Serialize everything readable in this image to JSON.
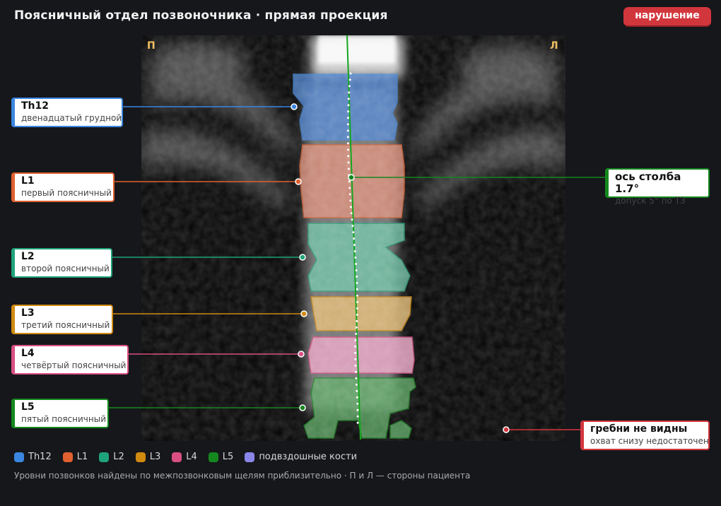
{
  "header": {
    "title": "Поясничный отдел позвоночника · прямая проекция",
    "status_badge": "нарушение"
  },
  "scan": {
    "side_right": "П",
    "side_left": "Л"
  },
  "vertebrae": [
    {
      "code": "Th12",
      "name": "двенадцатый грудной",
      "color": "#3a86e0"
    },
    {
      "code": "L1",
      "name": "первый поясничный",
      "color": "#e06030"
    },
    {
      "code": "L2",
      "name": "второй поясничный",
      "color": "#1fa37a"
    },
    {
      "code": "L3",
      "name": "третий поясничный",
      "color": "#d08a10"
    },
    {
      "code": "L4",
      "name": "четвёртый поясничный",
      "color": "#d94f82"
    },
    {
      "code": "L5",
      "name": "пятый поясничный",
      "color": "#14881e"
    }
  ],
  "axis_callout": {
    "title": "ось столба 1.7°",
    "subtitle": "допуск 5° по ТЗ",
    "color": "#14881e"
  },
  "warning_callout": {
    "title": "гребни не видны",
    "subtitle": "охват снизу недостаточен",
    "color": "#d2363d"
  },
  "legend": [
    {
      "label": "Th12",
      "color": "#3a86e0"
    },
    {
      "label": "L1",
      "color": "#e06030"
    },
    {
      "label": "L2",
      "color": "#1fa37a"
    },
    {
      "label": "L3",
      "color": "#d08a10"
    },
    {
      "label": "L4",
      "color": "#d94f82"
    },
    {
      "label": "L5",
      "color": "#14881e"
    },
    {
      "label": "подвздошные кости",
      "color": "#8a86e8"
    }
  ],
  "footnote": "Уровни позвонков найдены по межпозвонковым щелям приблизительно · П и Л — стороны пациента"
}
